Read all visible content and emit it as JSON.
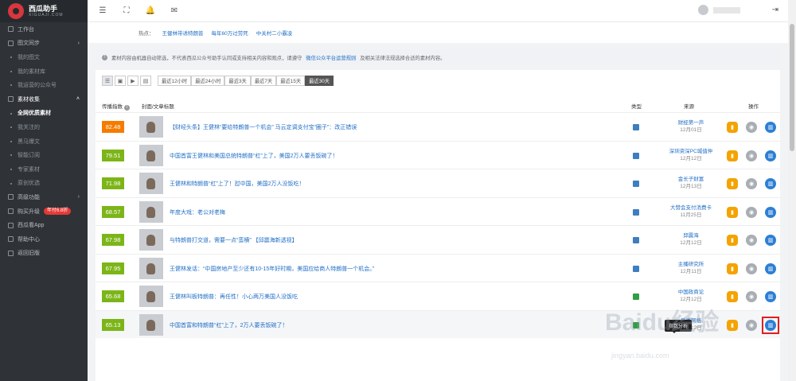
{
  "brand": {
    "name": "西瓜助手",
    "sub": "XIGUAJI.COM"
  },
  "sidebar": {
    "items": [
      {
        "label": "工作台",
        "type": "top",
        "icon": "dashboard-icon"
      },
      {
        "label": "图文同步",
        "type": "top",
        "icon": "sync-icon",
        "caret": "›"
      },
      {
        "label": "我的图文",
        "type": "sub"
      },
      {
        "label": "我的素材库",
        "type": "sub"
      },
      {
        "label": "我运营的公众号",
        "type": "sub"
      },
      {
        "label": "素材收集",
        "type": "top-open",
        "icon": "collect-icon",
        "caret": "˄"
      },
      {
        "label": "全网优质素材",
        "type": "sub-active"
      },
      {
        "label": "我关注的",
        "type": "sub"
      },
      {
        "label": "黑马爆文",
        "type": "sub"
      },
      {
        "label": "智能订阅",
        "type": "sub"
      },
      {
        "label": "专家素材",
        "type": "sub"
      },
      {
        "label": "原创优选",
        "type": "sub"
      },
      {
        "label": "高级功能",
        "type": "top",
        "icon": "advanced-icon",
        "caret": "›"
      },
      {
        "label": "购买升级",
        "type": "top",
        "icon": "upgrade-icon",
        "badge": "年付6.8折"
      },
      {
        "label": "西瓜看App",
        "type": "top",
        "icon": "app-icon"
      },
      {
        "label": "帮助中心",
        "type": "top",
        "icon": "help-icon"
      },
      {
        "label": "返回旧版",
        "type": "top",
        "icon": "back-icon"
      }
    ]
  },
  "hot": {
    "label": "热点：",
    "items": [
      "王健林带诱特朗普",
      "每年60万过劳死",
      "中关村二小霸凌"
    ]
  },
  "notice": {
    "text": "素材内容由机器自动筛选，不代表西瓜公众号助手认同或支持相关内容和观点，请遵守",
    "link": "微信公众平台运营规则",
    "tail": "及相关法律法规选择合适的素材内容。"
  },
  "filters": {
    "views": [
      "list-view-icon",
      "image-view-icon",
      "video-view-icon",
      "doc-view-icon"
    ],
    "ranges": [
      "最近12小时",
      "最近24小时",
      "最近3天",
      "最近7天",
      "最近15天",
      "最近30天"
    ],
    "active_range": 5
  },
  "table": {
    "headers": {
      "score": "传播指数",
      "title": "封面/文章标题",
      "type": "类型",
      "source": "来源",
      "action": "操作"
    },
    "rows": [
      {
        "score": "82.48",
        "color": "#f57c00",
        "title": "【财经头条】王健林“要给特朗普一个机会” 马云定调支付宝“圈子”：改正错误",
        "source": "财经第一声",
        "date": "12月01日",
        "type": "image"
      },
      {
        "score": "79.51",
        "color": "#7cb518",
        "title": "中国首富王健林和美国总统特朗普“杠”上了，美国2万人要丢饭碗了！",
        "source": "深圳资深PC城值仲",
        "date": "12月12日",
        "type": "image"
      },
      {
        "score": "71.98",
        "color": "#7cb518",
        "title": "王健林和特朗普“杠”上了！怼中国，美国2万人没饭吃！",
        "source": "金长子财富",
        "date": "12月13日",
        "type": "image"
      },
      {
        "score": "68.57",
        "color": "#7cb518",
        "title": "年度大戏：老公对老梅",
        "source": "大赞会支付消费卡",
        "date": "11月25日",
        "type": "image"
      },
      {
        "score": "67.98",
        "color": "#7cb518",
        "title": "与特朗普打交道，需要一点“蛮横” 【邱震海新透视】",
        "source": "邱震海",
        "date": "12月12日",
        "type": "image"
      },
      {
        "score": "67.95",
        "color": "#7cb518",
        "title": "王健林发话：“中国房地产至少还有10-15年好时期，美国应给商人特朗普一个机会。”",
        "source": "主播研究所",
        "date": "12月11日",
        "type": "image"
      },
      {
        "score": "65.68",
        "color": "#7cb518",
        "title": "王健林叫板特朗普：再任性！小心两万美国人没饭吃",
        "source": "中国政商论",
        "date": "12月12日",
        "type": "green"
      },
      {
        "score": "65.13",
        "color": "#7cb518",
        "title": "中国首富和特朗普“杠”上了，2万人要丢饭碗了！",
        "source": "凤凰网络",
        "date": "12月12日",
        "type": "green"
      }
    ]
  },
  "tooltip": "指数分析",
  "watermark": {
    "main": "Baidu经验",
    "sub": "jingyan.baidu.com"
  }
}
